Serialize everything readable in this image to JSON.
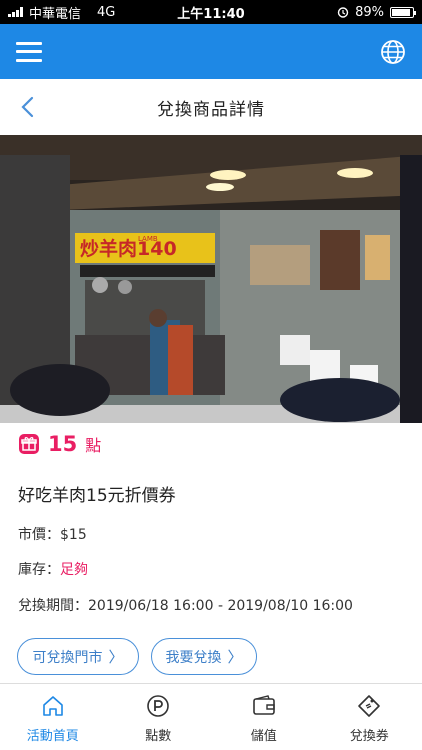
{
  "status_bar": {
    "carrier": "中華電信",
    "network": "4G",
    "time": "上午11:40",
    "battery": "89%"
  },
  "title_bar": {
    "title": "兌換商品詳情"
  },
  "hero": {
    "sign_text": "炒羊肉140",
    "sign_small": "LAMB"
  },
  "product": {
    "points_value": "15",
    "points_unit": "點",
    "name": "好吃羊肉15元折價券",
    "price_label": "市價：",
    "price_value": "$15",
    "stock_label": "庫存：",
    "stock_value": "足夠",
    "period_label": "兌換期間：",
    "period_value": "2019/06/18 16:00 - 2019/08/10 16:00"
  },
  "actions": {
    "stores_label": "可兌換門市",
    "redeem_label": "我要兌換",
    "chevron": "〉"
  },
  "tabs": [
    {
      "label": "活動首頁",
      "icon": "home-icon"
    },
    {
      "label": "點數",
      "icon": "points-icon"
    },
    {
      "label": "儲值",
      "icon": "wallet-icon"
    },
    {
      "label": "兌換券",
      "icon": "coupon-icon"
    }
  ],
  "colors": {
    "primary": "#1e88e5",
    "accent": "#e91e63"
  }
}
